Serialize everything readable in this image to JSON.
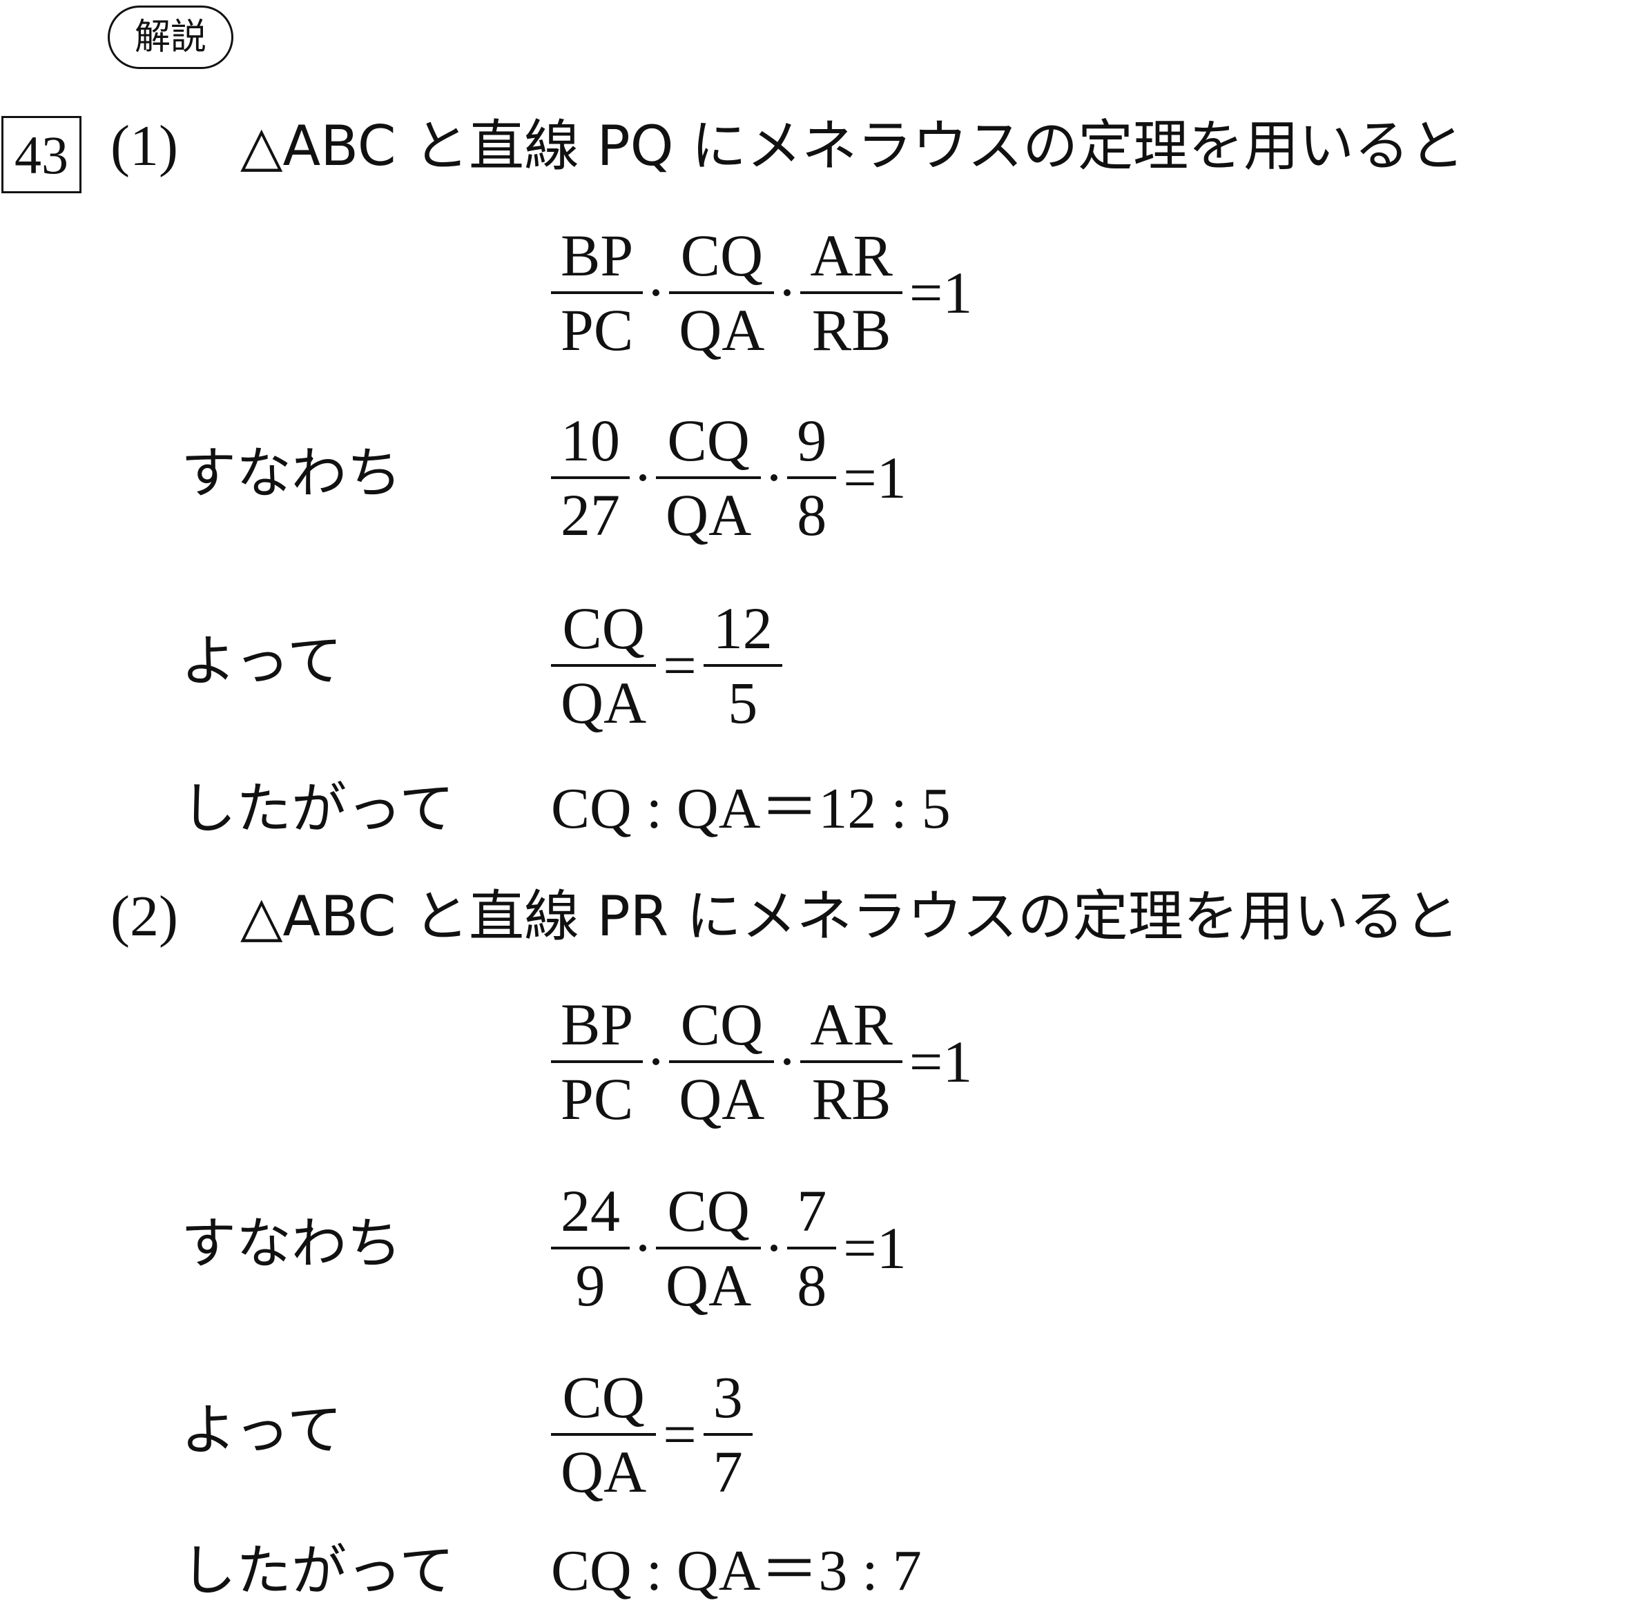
{
  "header": {
    "badge": "解説",
    "problem_number": "43"
  },
  "parts": [
    {
      "label": "(1)",
      "intro": "△ABC と直線 PQ にメネラウスの定理を用いると",
      "menelaus": {
        "f1": {
          "num": "BP",
          "den": "PC"
        },
        "f2": {
          "num": "CQ",
          "den": "QA"
        },
        "f3": {
          "num": "AR",
          "den": "RB"
        },
        "rhs": "=1"
      },
      "step1": {
        "label": "すなわち",
        "f1": {
          "num": "10",
          "den": "27"
        },
        "f2": {
          "num": "CQ",
          "den": "QA"
        },
        "f3": {
          "num": "9",
          "den": "8"
        },
        "rhs": "=1"
      },
      "step2": {
        "label": "よって",
        "lhs": {
          "num": "CQ",
          "den": "QA"
        },
        "eq": "=",
        "rhs": {
          "num": "12",
          "den": "5"
        }
      },
      "conclusion": {
        "label": "したがって",
        "text": "CQ : QA＝12 : 5"
      }
    },
    {
      "label": "(2)",
      "intro": "△ABC と直線 PR にメネラウスの定理を用いると",
      "menelaus": {
        "f1": {
          "num": "BP",
          "den": "PC"
        },
        "f2": {
          "num": "CQ",
          "den": "QA"
        },
        "f3": {
          "num": "AR",
          "den": "RB"
        },
        "rhs": "=1"
      },
      "step1": {
        "label": "すなわち",
        "f1": {
          "num": "24",
          "den": "9"
        },
        "f2": {
          "num": "CQ",
          "den": "QA"
        },
        "f3": {
          "num": "7",
          "den": "8"
        },
        "rhs": "=1"
      },
      "step2": {
        "label": "よって",
        "lhs": {
          "num": "CQ",
          "den": "QA"
        },
        "eq": "=",
        "rhs": {
          "num": "3",
          "den": "7"
        }
      },
      "conclusion": {
        "label": "したがって",
        "text": "CQ : QA＝3 : 7"
      }
    }
  ]
}
